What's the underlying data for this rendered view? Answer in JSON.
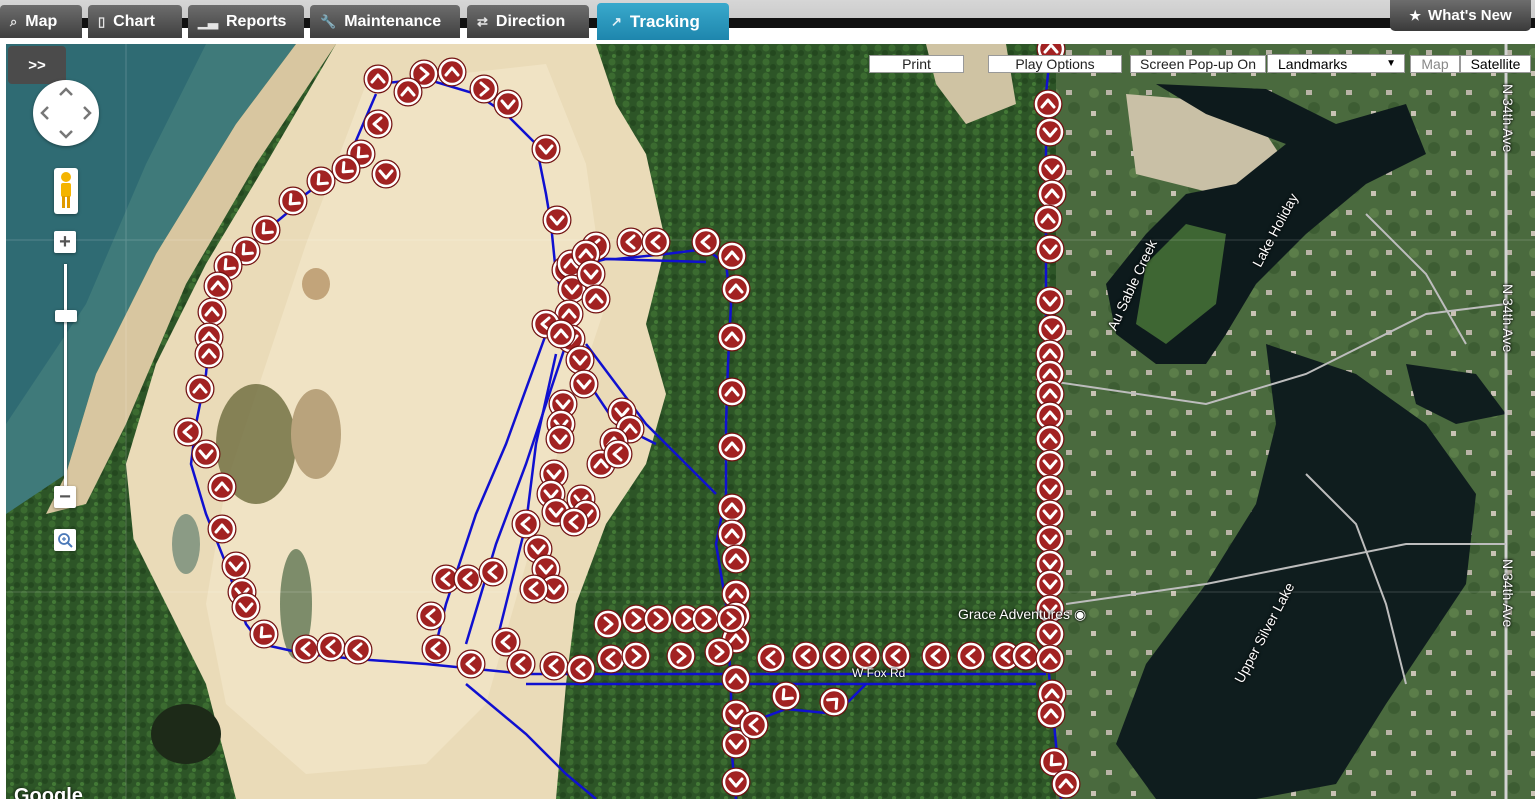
{
  "tabs": [
    {
      "label": "Map",
      "icon": "search-icon"
    },
    {
      "label": "Chart",
      "icon": "clipboard-icon"
    },
    {
      "label": "Reports",
      "icon": "bar-chart-icon"
    },
    {
      "label": "Maintenance",
      "icon": "wrench-icon"
    },
    {
      "label": "Direction",
      "icon": "swap-arrows-icon"
    },
    {
      "label": "Tracking",
      "icon": "external-link-icon",
      "active": true
    }
  ],
  "whats_new": {
    "label": "What's New",
    "icon": "star-icon"
  },
  "map_controls": {
    "expand_label": ">>",
    "print_label": "Print",
    "play_options_label": "Play Options",
    "screen_popup_label": "Screen Pop-up On",
    "landmarks_value": "Landmarks",
    "map_type_map": "Map",
    "map_type_satellite": "Satellite",
    "map_type_selected": "Satellite"
  },
  "map_labels": {
    "road_n34_a": "N 34th Ave",
    "road_n34_b": "N 34th Ave",
    "road_n34_c": "N 34th Ave",
    "creek": "Au Sable Creek",
    "lake_holiday": "Lake Holiday",
    "upper_silver_lake": "Upper Silver Lake",
    "business": "Grace Adventures",
    "road_fox": "W Fox Rd"
  },
  "logo_text": "Google",
  "colors": {
    "active_tab": "#2a98c0",
    "track_line": "#1010d0",
    "marker_fill": "#9a2020"
  }
}
